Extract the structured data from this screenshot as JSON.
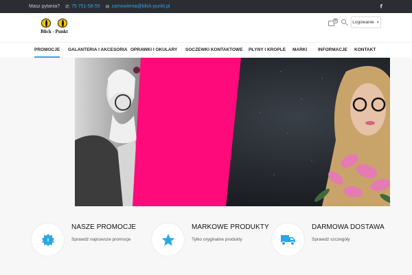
{
  "topbar": {
    "question": "Masz pytania?",
    "phone": "75 751-58-55",
    "email": "zamowienia@blick-punkt.pl",
    "social": "f"
  },
  "header": {
    "logo_text": "Blick - Punkt",
    "cart_count": "0",
    "login_label": "Logowanie"
  },
  "nav": {
    "items": [
      "PROMOCJE",
      "GALANTERIA I AKCESORIA",
      "OPRAWKI I OKULARY",
      "SOCZEWKI KONTAKTOWE",
      "PŁYNY I KROPLE",
      "MARKI",
      "INFORMACJE",
      "KONTAKT"
    ]
  },
  "features": [
    {
      "title": "NASZE PROMOCJE",
      "subtitle": "Sprawdź najnowsze promocje",
      "icon": "badge-icon"
    },
    {
      "title": "MARKOWE PRODUKTY",
      "subtitle": "Tylko oryginalne produkty",
      "icon": "star-icon"
    },
    {
      "title": "DARMOWA DOSTAWA",
      "subtitle": "Sprawdź szczegóły",
      "icon": "truck-icon"
    }
  ],
  "colors": {
    "accent": "#2aa7e6",
    "hero_pink": "#ff0a7a",
    "topbar": "#2b2d33"
  }
}
